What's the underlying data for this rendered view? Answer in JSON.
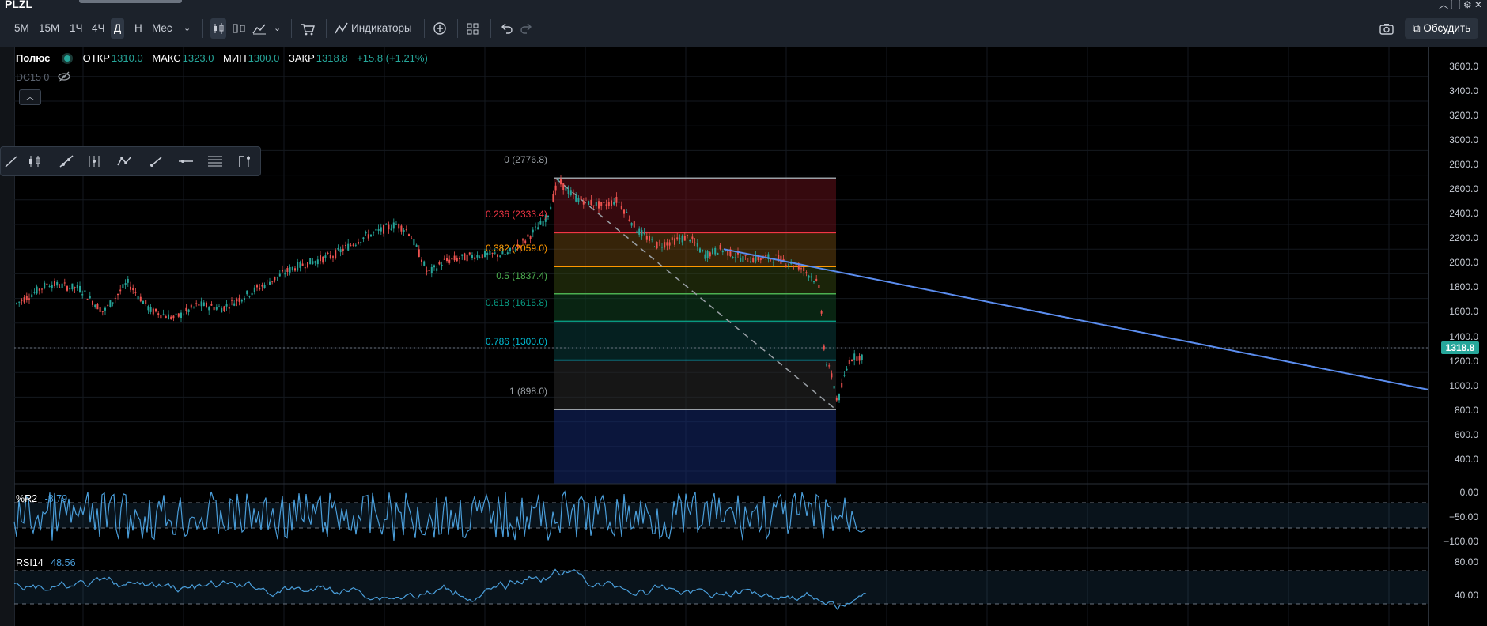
{
  "window": {
    "symbol": "PLZL"
  },
  "toolbar": {
    "timeframes": [
      "5М",
      "15М",
      "1Ч",
      "4Ч",
      "Д",
      "Н",
      "Мес"
    ],
    "active_timeframe": "Д",
    "indicators_label": "Индикаторы",
    "discuss_label": "Обсудить"
  },
  "legend": {
    "name": "Полюс",
    "open_label": "ОТКР",
    "open": "1310.0",
    "high_label": "МАКС",
    "high": "1323.0",
    "low_label": "МИН",
    "low": "1300.0",
    "close_label": "ЗАКР",
    "close": "1318.8",
    "change": "+15.8 (+1.21%)",
    "dc_label": "DC15 0"
  },
  "price_axis": {
    "labels": [
      "3600.0",
      "3400.0",
      "3200.0",
      "3000.0",
      "2800.0",
      "2600.0",
      "2400.0",
      "2200.0",
      "2000.0",
      "1800.0",
      "1600.0",
      "1400.0",
      "1200.0",
      "1000.0",
      "800.0",
      "600.0",
      "400.0"
    ],
    "current_price": "1318.8"
  },
  "fib": {
    "levels": [
      {
        "label": "0 (2776.8)",
        "color": "#9aa0a6"
      },
      {
        "label": "0.236 (2333.4)",
        "color": "#f23645"
      },
      {
        "label": "0.382 (2059.0)",
        "color": "#ff9800"
      },
      {
        "label": "0.5 (1837.4)",
        "color": "#4caf50"
      },
      {
        "label": "0.618 (1615.8)",
        "color": "#089981"
      },
      {
        "label": "0.786 (1300.0)",
        "color": "#00bcd4"
      },
      {
        "label": "1 (898.0)",
        "color": "#9aa0a6"
      }
    ]
  },
  "r2": {
    "label": "%R2",
    "value": "-8.79",
    "axis": [
      "0.00",
      "−50.00",
      "−100.00"
    ]
  },
  "rsi": {
    "label": "RSI14",
    "value": "48.56",
    "axis": [
      "80.00",
      "40.00"
    ]
  },
  "colors": {
    "up": "#26a69a",
    "down": "#ef5350",
    "trend": "#5b8def",
    "osc": "#4a9eda"
  }
}
